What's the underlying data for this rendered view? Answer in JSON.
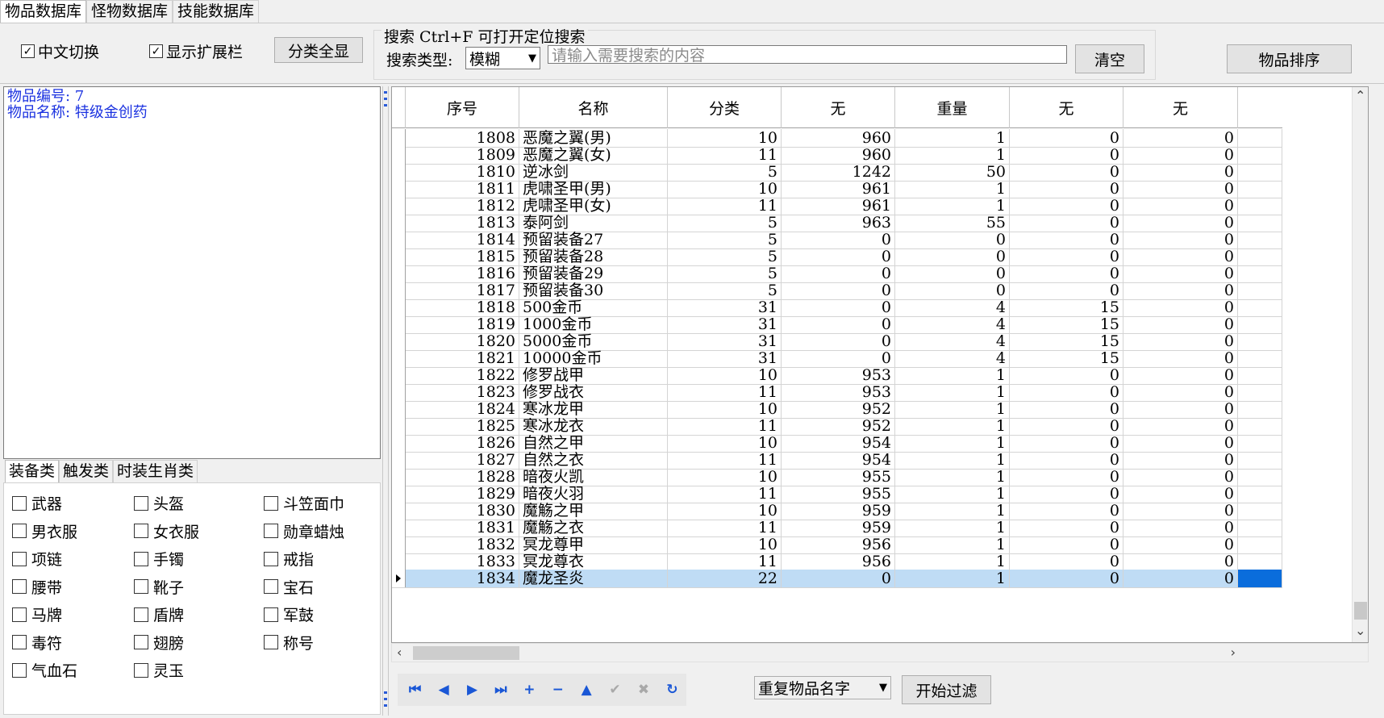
{
  "top_tabs": [
    "物品数据库",
    "怪物数据库",
    "技能数据库"
  ],
  "toolbar": {
    "chinese_toggle": "中文切换",
    "show_ext_bar": "显示扩展栏",
    "show_all_categories": "分类全显",
    "search_legend": "搜索   Ctrl+F 可打开定位搜索",
    "search_type_label": "搜索类型:",
    "search_type_value": "模糊",
    "search_placeholder": "请输入需要搜索的内容",
    "clear_button": "清空",
    "sort_button": "物品排序"
  },
  "item_info": {
    "line1": "物品编号: 7",
    "line2": "物品名称: 特级金创药"
  },
  "category_tabs": [
    "装备类",
    "触发类",
    "时装生肖类"
  ],
  "categories": [
    [
      "武器",
      "头盔",
      "斗笠面巾"
    ],
    [
      "男衣服",
      "女衣服",
      "勋章蜡烛"
    ],
    [
      "项链",
      "手镯",
      "戒指"
    ],
    [
      "腰带",
      "靴子",
      "宝石"
    ],
    [
      "马牌",
      "盾牌",
      "军鼓"
    ],
    [
      "毒符",
      "翅膀",
      "称号"
    ],
    [
      "气血石",
      "灵玉",
      ""
    ]
  ],
  "grid": {
    "columns": [
      "序号",
      "名称",
      "分类",
      "无",
      "重量",
      "无",
      "无"
    ],
    "rows": [
      [
        "1808",
        "恶魔之翼(男)",
        "10",
        "960",
        "1",
        "0",
        "0"
      ],
      [
        "1809",
        "恶魔之翼(女)",
        "11",
        "960",
        "1",
        "0",
        "0"
      ],
      [
        "1810",
        "逆冰剑",
        "5",
        "1242",
        "50",
        "0",
        "0"
      ],
      [
        "1811",
        "虎啸圣甲(男)",
        "10",
        "961",
        "1",
        "0",
        "0"
      ],
      [
        "1812",
        "虎啸圣甲(女)",
        "11",
        "961",
        "1",
        "0",
        "0"
      ],
      [
        "1813",
        "泰阿剑",
        "5",
        "963",
        "55",
        "0",
        "0"
      ],
      [
        "1814",
        "预留装备27",
        "5",
        "0",
        "0",
        "0",
        "0"
      ],
      [
        "1815",
        "预留装备28",
        "5",
        "0",
        "0",
        "0",
        "0"
      ],
      [
        "1816",
        "预留装备29",
        "5",
        "0",
        "0",
        "0",
        "0"
      ],
      [
        "1817",
        "预留装备30",
        "5",
        "0",
        "0",
        "0",
        "0"
      ],
      [
        "1818",
        "500金币",
        "31",
        "0",
        "4",
        "15",
        "0"
      ],
      [
        "1819",
        "1000金币",
        "31",
        "0",
        "4",
        "15",
        "0"
      ],
      [
        "1820",
        "5000金币",
        "31",
        "0",
        "4",
        "15",
        "0"
      ],
      [
        "1821",
        "10000金币",
        "31",
        "0",
        "4",
        "15",
        "0"
      ],
      [
        "1822",
        "修罗战甲",
        "10",
        "953",
        "1",
        "0",
        "0"
      ],
      [
        "1823",
        "修罗战衣",
        "11",
        "953",
        "1",
        "0",
        "0"
      ],
      [
        "1824",
        "寒冰龙甲",
        "10",
        "952",
        "1",
        "0",
        "0"
      ],
      [
        "1825",
        "寒冰龙衣",
        "11",
        "952",
        "1",
        "0",
        "0"
      ],
      [
        "1826",
        "自然之甲",
        "10",
        "954",
        "1",
        "0",
        "0"
      ],
      [
        "1827",
        "自然之衣",
        "11",
        "954",
        "1",
        "0",
        "0"
      ],
      [
        "1828",
        "暗夜火凯",
        "10",
        "955",
        "1",
        "0",
        "0"
      ],
      [
        "1829",
        "暗夜火羽",
        "11",
        "955",
        "1",
        "0",
        "0"
      ],
      [
        "1830",
        "魔觞之甲",
        "10",
        "959",
        "1",
        "0",
        "0"
      ],
      [
        "1831",
        "魔觞之衣",
        "11",
        "959",
        "1",
        "0",
        "0"
      ],
      [
        "1832",
        "冥龙尊甲",
        "10",
        "956",
        "1",
        "0",
        "0"
      ],
      [
        "1833",
        "冥龙尊衣",
        "11",
        "956",
        "1",
        "0",
        "0"
      ],
      [
        "1834",
        "魔龙圣炎",
        "22",
        "0",
        "1",
        "0",
        "0"
      ]
    ],
    "selected_row": 26
  },
  "nav_buttons": [
    {
      "icon": "first-record-icon",
      "glyph": "⏮"
    },
    {
      "icon": "prior-record-icon",
      "glyph": "◀"
    },
    {
      "icon": "next-record-icon",
      "glyph": "▶"
    },
    {
      "icon": "last-record-icon",
      "glyph": "⏭"
    },
    {
      "icon": "insert-record-icon",
      "glyph": "+"
    },
    {
      "icon": "delete-record-icon",
      "glyph": "−"
    },
    {
      "icon": "edit-record-icon",
      "glyph": "▲"
    },
    {
      "icon": "post-record-icon",
      "glyph": "✔"
    },
    {
      "icon": "cancel-record-icon",
      "glyph": "✖"
    },
    {
      "icon": "refresh-record-icon",
      "glyph": "↻"
    }
  ],
  "filter": {
    "select_value": "重复物品名字",
    "start_button": "开始过滤"
  }
}
